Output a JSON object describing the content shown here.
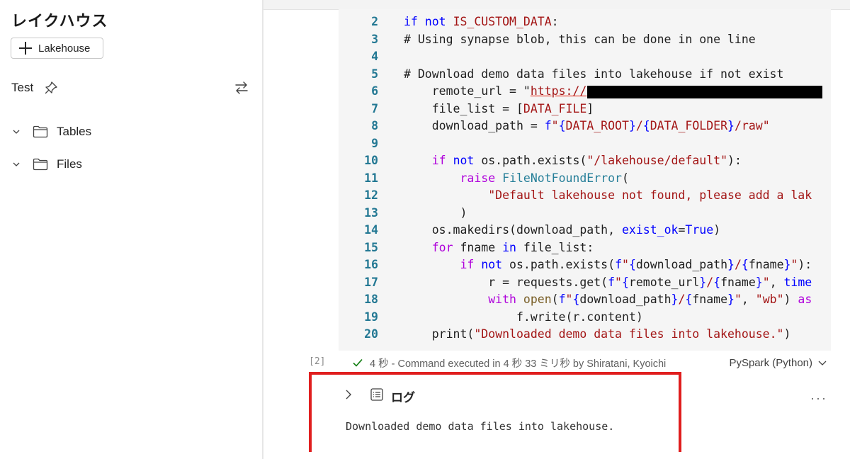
{
  "sidebar": {
    "title": "レイクハウス",
    "add_button_label": "Lakehouse",
    "lakehouse_name": "Test",
    "tree": [
      {
        "label": "Tables"
      },
      {
        "label": "Files"
      }
    ]
  },
  "code": {
    "lines": [
      {
        "num": "2",
        "indent": 0,
        "tokens": [
          [
            "kw",
            "if "
          ],
          [
            "kw",
            "not "
          ],
          [
            "str",
            "IS_CUSTOM_DATA"
          ],
          [
            "txt",
            ":"
          ]
        ]
      },
      {
        "num": "3",
        "indent": 0,
        "tokens": [
          [
            "txt",
            "# Using synapse blob, this can be done in one line"
          ]
        ]
      },
      {
        "num": "4",
        "indent": 0,
        "tokens": []
      },
      {
        "num": "5",
        "indent": 0,
        "tokens": [
          [
            "txt",
            "# Download demo data files into lakehouse if not exist"
          ]
        ]
      },
      {
        "num": "6",
        "indent": 4,
        "tokens": [
          [
            "txt",
            "remote_url = \""
          ],
          [
            "url",
            "https://"
          ],
          [
            "redact",
            ""
          ]
        ]
      },
      {
        "num": "7",
        "indent": 4,
        "tokens": [
          [
            "txt",
            "file_list = ["
          ],
          [
            "str",
            "DATA_FILE"
          ],
          [
            "txt",
            "]"
          ]
        ]
      },
      {
        "num": "8",
        "indent": 4,
        "tokens": [
          [
            "txt",
            "download_path = "
          ],
          [
            "kw",
            "f"
          ],
          [
            "str",
            "\""
          ],
          [
            "kw",
            "{"
          ],
          [
            "str",
            "DATA_ROOT"
          ],
          [
            "kw",
            "}"
          ],
          [
            "str",
            "/"
          ],
          [
            "kw",
            "{"
          ],
          [
            "str",
            "DATA_FOLDER"
          ],
          [
            "kw",
            "}"
          ],
          [
            "str",
            "/raw\""
          ]
        ]
      },
      {
        "num": "9",
        "indent": 0,
        "tokens": []
      },
      {
        "num": "10",
        "indent": 4,
        "tokens": [
          [
            "ctl",
            "if "
          ],
          [
            "kw",
            "not "
          ],
          [
            "txt",
            "os.path.exists("
          ],
          [
            "str",
            "\"/lakehouse/default\""
          ],
          [
            "txt",
            "):"
          ]
        ]
      },
      {
        "num": "11",
        "indent": 8,
        "tokens": [
          [
            "ctl",
            "raise "
          ],
          [
            "cls",
            "FileNotFoundError"
          ],
          [
            "txt",
            "("
          ]
        ]
      },
      {
        "num": "12",
        "indent": 12,
        "tokens": [
          [
            "str",
            "\"Default lakehouse not found, please add a lak"
          ]
        ]
      },
      {
        "num": "13",
        "indent": 8,
        "tokens": [
          [
            "txt",
            ")"
          ]
        ]
      },
      {
        "num": "14",
        "indent": 4,
        "tokens": [
          [
            "txt",
            "os.makedirs(download_path, "
          ],
          [
            "kw",
            "exist_ok"
          ],
          [
            "txt",
            "="
          ],
          [
            "bool",
            "True"
          ],
          [
            "txt",
            ")"
          ]
        ]
      },
      {
        "num": "15",
        "indent": 4,
        "tokens": [
          [
            "ctl",
            "for "
          ],
          [
            "txt",
            "fname "
          ],
          [
            "kw",
            "in "
          ],
          [
            "txt",
            "file_list:"
          ]
        ]
      },
      {
        "num": "16",
        "indent": 8,
        "tokens": [
          [
            "ctl",
            "if "
          ],
          [
            "kw",
            "not "
          ],
          [
            "txt",
            "os.path.exists("
          ],
          [
            "kw",
            "f"
          ],
          [
            "str",
            "\""
          ],
          [
            "kw",
            "{"
          ],
          [
            "txt",
            "download_path"
          ],
          [
            "kw",
            "}"
          ],
          [
            "str",
            "/"
          ],
          [
            "kw",
            "{"
          ],
          [
            "txt",
            "fname"
          ],
          [
            "kw",
            "}"
          ],
          [
            "str",
            "\""
          ],
          [
            "txt",
            "):"
          ]
        ]
      },
      {
        "num": "17",
        "indent": 12,
        "tokens": [
          [
            "txt",
            "r = requests.get("
          ],
          [
            "kw",
            "f"
          ],
          [
            "str",
            "\""
          ],
          [
            "kw",
            "{"
          ],
          [
            "txt",
            "remote_url"
          ],
          [
            "kw",
            "}"
          ],
          [
            "str",
            "/"
          ],
          [
            "kw",
            "{"
          ],
          [
            "txt",
            "fname"
          ],
          [
            "kw",
            "}"
          ],
          [
            "str",
            "\""
          ],
          [
            "txt",
            ", "
          ],
          [
            "kw",
            "time"
          ]
        ]
      },
      {
        "num": "18",
        "indent": 12,
        "tokens": [
          [
            "ctl",
            "with "
          ],
          [
            "fn",
            "open"
          ],
          [
            "txt",
            "("
          ],
          [
            "kw",
            "f"
          ],
          [
            "str",
            "\""
          ],
          [
            "kw",
            "{"
          ],
          [
            "txt",
            "download_path"
          ],
          [
            "kw",
            "}"
          ],
          [
            "str",
            "/"
          ],
          [
            "kw",
            "{"
          ],
          [
            "txt",
            "fname"
          ],
          [
            "kw",
            "}"
          ],
          [
            "str",
            "\""
          ],
          [
            "txt",
            ", "
          ],
          [
            "str",
            "\"wb\""
          ],
          [
            "txt",
            ") "
          ],
          [
            "ctl",
            "as"
          ]
        ]
      },
      {
        "num": "19",
        "indent": 16,
        "tokens": [
          [
            "txt",
            "f.write(r.content)"
          ]
        ]
      },
      {
        "num": "20",
        "indent": 4,
        "tokens": [
          [
            "txt",
            "print("
          ],
          [
            "str",
            "\"Downloaded demo data files into lakehouse.\""
          ],
          [
            "txt",
            ")"
          ]
        ]
      }
    ]
  },
  "cell": {
    "exec_label": "[2]",
    "status": "4 秒 - Command executed in 4 秒 33 ミリ秒 by Shiratani, Kyoichi",
    "language": "PySpark (Python)"
  },
  "output": {
    "title": "ログ",
    "text": "Downloaded demo data files into lakehouse."
  },
  "colors": {
    "highlight_border": "#e01e1e",
    "code_bg": "#f5f5f5",
    "check": "#107c10"
  },
  "icons": {
    "more": "···"
  }
}
